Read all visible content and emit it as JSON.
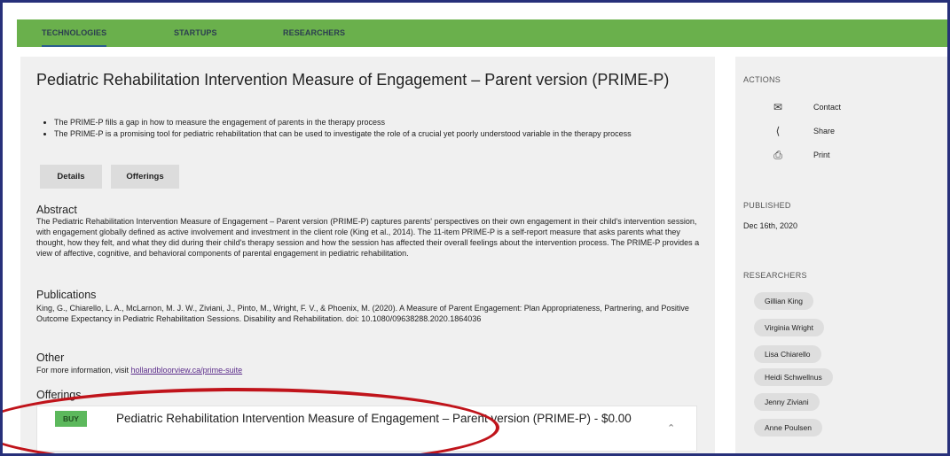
{
  "nav": {
    "tabs": [
      {
        "label": "TECHNOLOGIES",
        "active": true
      },
      {
        "label": "STARTUPS",
        "active": false
      },
      {
        "label": "RESEARCHERS",
        "active": false
      }
    ]
  },
  "main": {
    "title": "Pediatric Rehabilitation Intervention Measure of Engagement – Parent version (PRIME-P)",
    "bullets": [
      "The PRIME-P fills a gap in how to measure the engagement of parents in the therapy process",
      "The PRIME-P is a promising tool for pediatric rehabilitation that can be used to investigate the role of a crucial yet poorly understood variable in the therapy process"
    ],
    "buttons": {
      "details": "Details",
      "offerings": "Offerings"
    },
    "abstract": {
      "heading": "Abstract",
      "text": "The Pediatric Rehabilitation Intervention Measure of Engagement – Parent version (PRIME-P) captures parents' perspectives on their own engagement in their child's intervention session, with engagement globally defined as active involvement and investment in the client role (King et al., 2014). The 11-item PRIME-P is a self-report measure that asks parents what they thought, how they felt, and what they did during their child's therapy session and how the session has affected their overall feelings about the intervention process. The PRIME-P provides a view of affective, cognitive, and behavioral components of parental engagement in pediatric rehabilitation."
    },
    "publications": {
      "heading": "Publications",
      "text": "King, G., Chiarello, L. A., McLarnon, M. J. W., Ziviani, J., Pinto, M., Wright, F. V., & Phoenix, M. (2020). A Measure of Parent Engagement: Plan Appropriateness, Partnering, and Positive Outcome Expectancy in Pediatric Rehabilitation Sessions. Disability and Rehabilitation. doi: 10.1080/09638288.2020.1864036"
    },
    "other": {
      "heading": "Other",
      "prefix": "For more information, visit ",
      "link": "hollandbloorview.ca/prime-suite"
    },
    "offerings": {
      "heading": "Offerings",
      "item": {
        "buy_label": "BUY",
        "title": "Pediatric Rehabilitation Intervention Measure of Engagement – Parent version (PRIME-P) - $0.00"
      }
    }
  },
  "sidebar": {
    "actions_heading": "ACTIONS",
    "actions": [
      {
        "label": "Contact",
        "icon": "envelope-icon"
      },
      {
        "label": "Share",
        "icon": "share-icon"
      },
      {
        "label": "Print",
        "icon": "printer-icon"
      }
    ],
    "published_heading": "PUBLISHED",
    "published_date": "Dec 16th, 2020",
    "researchers_heading": "RESEARCHERS",
    "researchers": [
      "Gillian King",
      "Virginia Wright",
      "Lisa Chiarello",
      "Heidi Schwellnus",
      "Jenny Ziviani",
      "Anne Poulsen"
    ]
  },
  "colors": {
    "nav_green": "#6ab04c",
    "buy_green": "#5cb85c",
    "highlight_red": "#c0141b",
    "frame_navy": "#27307a"
  }
}
